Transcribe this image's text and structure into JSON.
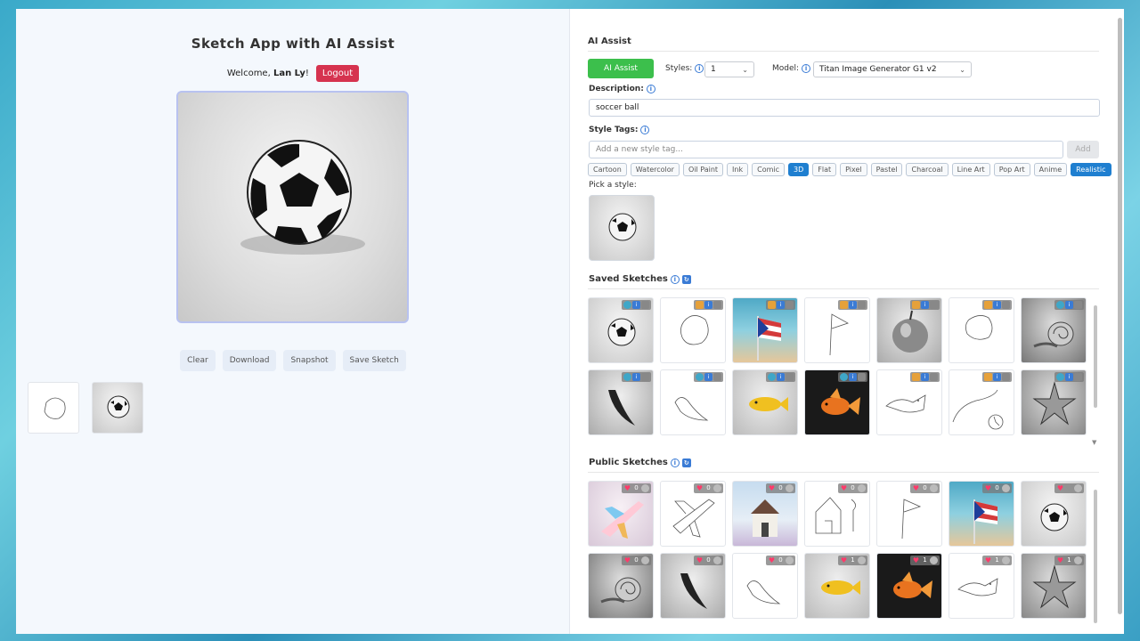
{
  "app": {
    "title": "Sketch App with AI Assist",
    "welcome_prefix": "Welcome, ",
    "user_name": "Lan Ly",
    "welcome_suffix": "!",
    "logout_label": "Logout"
  },
  "toolbar": {
    "clear_label": "Clear",
    "download_label": "Download",
    "snapshot_label": "Snapshot",
    "save_label": "Save Sketch"
  },
  "ai_panel": {
    "section_title": "AI Assist",
    "ai_button_label": "AI Assist",
    "styles_label": "Styles:",
    "styles_value": "1",
    "model_label": "Model:",
    "model_value": "Titan Image Generator G1 v2",
    "description_label": "Description:",
    "description_value": "soccer ball",
    "style_tags_label": "Style Tags:",
    "style_tag_placeholder": "Add a new style tag...",
    "add_label": "Add",
    "tags": [
      {
        "label": "Cartoon",
        "active": false
      },
      {
        "label": "Watercolor",
        "active": false
      },
      {
        "label": "Oil Paint",
        "active": false
      },
      {
        "label": "Ink",
        "active": false
      },
      {
        "label": "Comic",
        "active": false
      },
      {
        "label": "3D",
        "active": true
      },
      {
        "label": "Flat",
        "active": false
      },
      {
        "label": "Pixel",
        "active": false
      },
      {
        "label": "Pastel",
        "active": false
      },
      {
        "label": "Charcoal",
        "active": false
      },
      {
        "label": "Line Art",
        "active": false
      },
      {
        "label": "Pop Art",
        "active": false
      },
      {
        "label": "Anime",
        "active": false
      },
      {
        "label": "Realistic",
        "active": true
      }
    ],
    "pick_style_label": "Pick a style:"
  },
  "saved": {
    "section_title": "Saved Sketches"
  },
  "public": {
    "section_title": "Public Sketches",
    "row1_counts": [
      "0",
      "0",
      "0",
      "0",
      "0",
      "0",
      ""
    ],
    "row2_counts": [
      "0",
      "0",
      "0",
      "1",
      "1",
      "1",
      "1"
    ]
  }
}
